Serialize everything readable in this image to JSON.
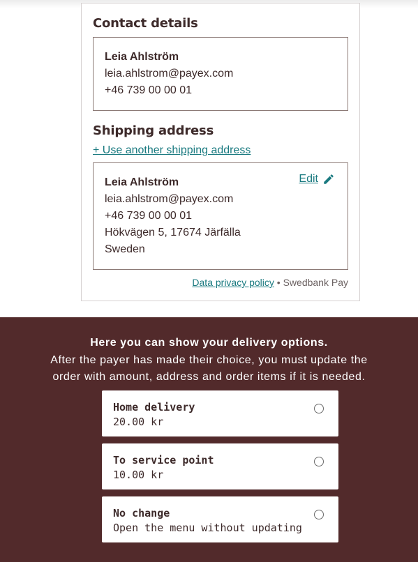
{
  "contact": {
    "title": "Contact details",
    "name": "Leia Ahlström",
    "email": "leia.ahlstrom@payex.com",
    "phone": "+46 739 00 00 01"
  },
  "shipping": {
    "title": "Shipping address",
    "use_another_link": "+ Use another shipping address",
    "name": "Leia Ahlström",
    "email": "leia.ahlstrom@payex.com",
    "phone": "+46 739 00 00 01",
    "street": "Hökvägen 5, 17674 Järfälla",
    "country": "Sweden",
    "edit_label": "Edit",
    "edit_icon": "pencil-icon"
  },
  "footer": {
    "privacy_link": "Data privacy policy",
    "separator": " • ",
    "brand": "Swedbank Pay"
  },
  "delivery": {
    "headline": "Here you can show your delivery options.",
    "description_line1": "After the payer has made their choice, you must update the",
    "description_line2": "order with amount, address and order items if it is needed.",
    "options": [
      {
        "title": "Home delivery",
        "subtitle": "20.00 kr",
        "selected": false
      },
      {
        "title": "To service point",
        "subtitle": "10.00 kr",
        "selected": false
      },
      {
        "title": "No change",
        "subtitle": "Open the menu without updating",
        "selected": false
      }
    ]
  },
  "colors": {
    "accent_link": "#1a7a80",
    "brand_background": "#522a2b",
    "text_dark": "#3d2a2a"
  }
}
